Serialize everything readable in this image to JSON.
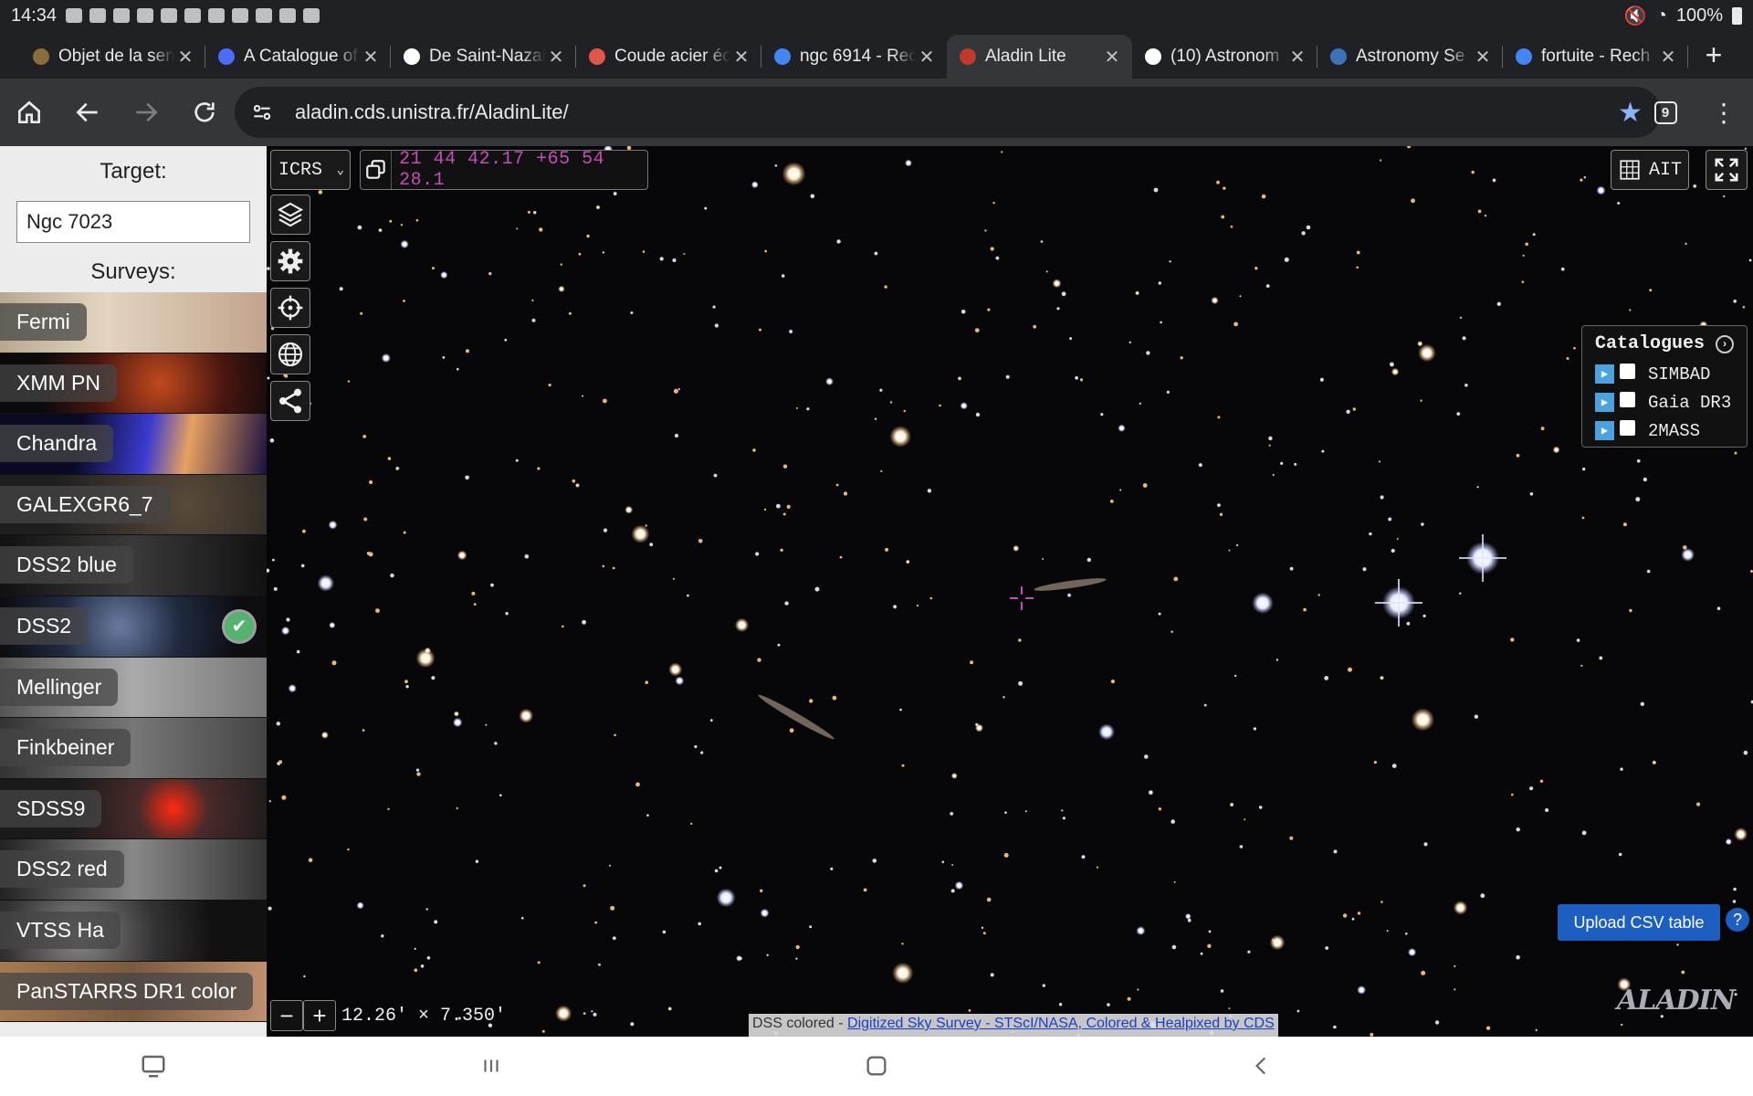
{
  "status_bar": {
    "time": "14:34",
    "battery": "100%"
  },
  "tabs": [
    {
      "title": "Objet de la sen",
      "favicon_color": "#8a6d3b",
      "active": false
    },
    {
      "title": "A Catalogue of",
      "favicon_color": "#4a6cf7",
      "active": false
    },
    {
      "title": "De Saint-Nazai",
      "favicon_color": "#ffffff",
      "active": false
    },
    {
      "title": "Coude acier éc",
      "favicon_color": "#e0564b",
      "active": false
    },
    {
      "title": "ngc 6914 - Rec",
      "favicon_color": "#4285f4",
      "active": false
    },
    {
      "title": "Aladin Lite",
      "favicon_color": "#c0392b",
      "active": true
    },
    {
      "title": "(10) Astronom",
      "favicon_color": "#ffffff",
      "active": false
    },
    {
      "title": "Astronomy Se",
      "favicon_color": "#3b73b9",
      "active": false
    },
    {
      "title": "fortuite - Rech",
      "favicon_color": "#4285f4",
      "active": false
    }
  ],
  "toolbar": {
    "url": "aladin.cds.unistra.fr/AladinLite/",
    "tab_count": "9"
  },
  "left_panel": {
    "target_label": "Target:",
    "target_value": "Ngc 7023",
    "surveys_label": "Surveys:",
    "surveys": [
      {
        "name": "Fermi",
        "selected": false
      },
      {
        "name": "XMM PN",
        "selected": false
      },
      {
        "name": "Chandra",
        "selected": false
      },
      {
        "name": "GALEXGR6_7",
        "selected": false
      },
      {
        "name": "DSS2 blue",
        "selected": false
      },
      {
        "name": "DSS2",
        "selected": true
      },
      {
        "name": "Mellinger",
        "selected": false
      },
      {
        "name": "Finkbeiner",
        "selected": false
      },
      {
        "name": "SDSS9",
        "selected": false
      },
      {
        "name": "DSS2 red",
        "selected": false
      },
      {
        "name": "VTSS Ha",
        "selected": false
      },
      {
        "name": "PanSTARRS DR1 color",
        "selected": false
      }
    ]
  },
  "sky": {
    "frame": "ICRS",
    "coordinates": "21 44 42.17 +65 54 28.1",
    "projection": "AIT",
    "catalogues_title": "Catalogues",
    "catalogues": [
      "SIMBAD",
      "Gaia DR3",
      "2MASS"
    ],
    "upload_label": "Upload CSV table",
    "help_label": "?",
    "zoom_out": "−",
    "zoom_in": "+",
    "fov": "12.26' × 7.350'",
    "credit_prefix": "DSS colored - ",
    "credit_link": "Digitized Sky Survey - STScI/NASA, Colored & Healpixed by CDS",
    "logo": "ALADIN",
    "reticle_color": "#c44db9"
  }
}
